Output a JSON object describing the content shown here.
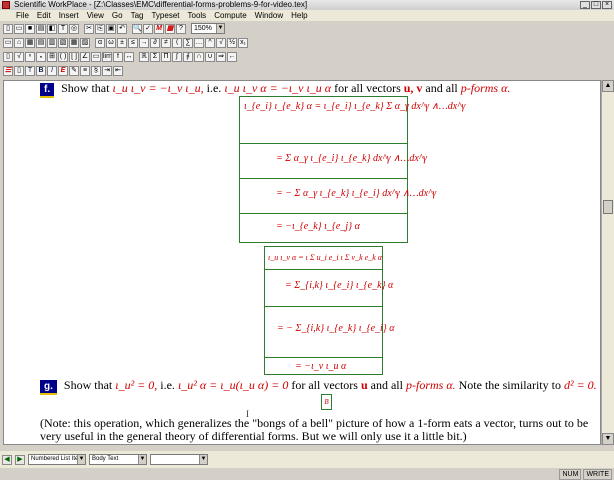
{
  "window": {
    "title": "Scientific WorkPlace - [Z:\\Classes\\EMC\\differential-forms-problems-9-for-video.tex]"
  },
  "menu": [
    "File",
    "Edit",
    "Insert",
    "View",
    "Go",
    "Tag",
    "Typeset",
    "Tools",
    "Compute",
    "Window",
    "Help"
  ],
  "toolbar": {
    "zoom": "150%",
    "text_button": "T",
    "bold_button": "B",
    "italic_button": "I"
  },
  "doc": {
    "f_label": "f.",
    "f_text_1": "Show that",
    "f_eq_1": "ι_u ι_v = −ι_v ι_u,",
    "f_text_2": "i.e.",
    "f_eq_2": "ι_u ι_v α = −ι_v ι_u α",
    "f_text_3": "for all vectors",
    "f_vectors": "u, v",
    "f_text_4": "and all",
    "f_pforms": "p-forms",
    "f_alpha": "α.",
    "box1": [
      "ι_{e_i} ι_{e_k} α = ι_{e_i} ι_{e_k} Σ α_γ dx^γ ∧…dx^γ",
      "= Σ α_γ ι_{e_i} ι_{e_k} dx^γ ∧…dx^γ",
      "= − Σ α_γ ι_{e_k} ι_{e_i} dx^γ ∧…dx^γ",
      "= −ι_{e_k} ι_{e_j} α"
    ],
    "box2": [
      "ι_u ι_v α = ι Σ u_i e_i ι Σ v_k e_k α",
      "= Σ_{i,k} ι_{e_i} ι_{e_k} α",
      "= − Σ_{i,k} ι_{e_k} ι_{e_i} α",
      "= −ι_v ι_u α"
    ],
    "g_label": "g.",
    "g_text_1": "Show that",
    "g_eq_1": "ι_u² = 0,",
    "g_text_2": "i.e.",
    "g_eq_2": "ι_u² α = ι_u(ι_u α) = 0",
    "g_text_3": "for all vectors",
    "g_vec": "u",
    "g_text_4": "and all",
    "g_pforms": "p-forms",
    "g_alpha": "α.",
    "g_text_5": "Note the similarity to",
    "g_d2": "d² = 0.",
    "note_line1": "(Note: this operation, which generalizes the \"bongs of a bell\" picture of how a 1-form eats a vector, turns out to be",
    "note_line2": "very useful in the general theory of differential forms. But we will only use it a little bit.)"
  },
  "status": {
    "list_style": "Numbered List Item",
    "text_style": "Body Text",
    "third": "",
    "num": "NUM",
    "write": "WRITE"
  }
}
